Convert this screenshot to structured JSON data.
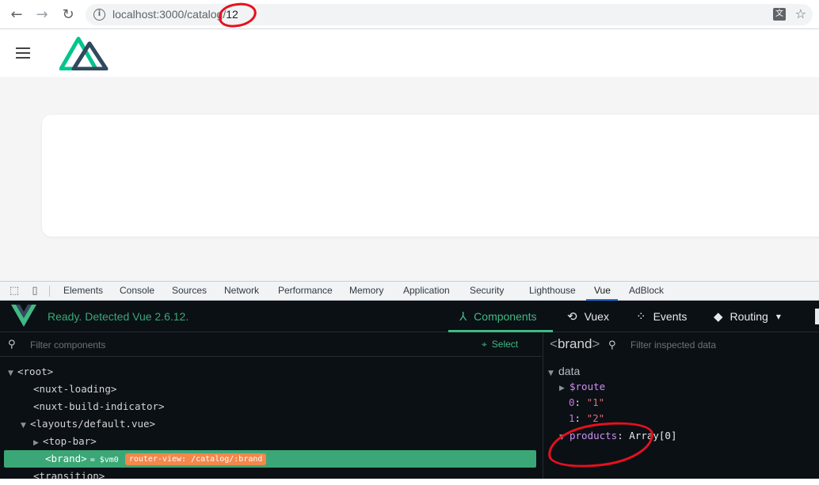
{
  "browser": {
    "url_host": "localhost:3000/catalog/",
    "url_path": "12",
    "back_icon": "arrow-left-icon",
    "forward_icon": "arrow-right-icon",
    "reload_icon": "reload-icon"
  },
  "devtools": {
    "tabs": [
      "Elements",
      "Console",
      "Sources",
      "Network",
      "Performance",
      "Memory",
      "Application",
      "Security",
      "Lighthouse",
      "Vue",
      "AdBlock"
    ],
    "active_tab": "Vue"
  },
  "vue": {
    "status": "Ready. Detected Vue 2.6.12.",
    "nav": {
      "components": "Components",
      "vuex": "Vuex",
      "events": "Events",
      "routing": "Routing"
    },
    "filter_placeholder": "Filter components",
    "select_label": "Select",
    "tree": [
      {
        "tag": "root"
      },
      {
        "tag": "nuxt-loading"
      },
      {
        "tag": "nuxt-build-indicator"
      },
      {
        "tag": "layouts/default.vue"
      },
      {
        "tag": "top-bar"
      },
      {
        "tag": "brand",
        "ref": "= $vm0",
        "badge": "router-view: /catalog/:brand"
      },
      {
        "tag": "transition"
      }
    ],
    "inspector": {
      "component": "brand",
      "filter_placeholder": "Filter inspected data",
      "section": "data",
      "route_key": "$route",
      "entries": [
        {
          "key": "0",
          "value": "\"1\""
        },
        {
          "key": "1",
          "value": "\"2\""
        }
      ],
      "products_key": "products",
      "products_value": "Array[0]"
    }
  },
  "colors": {
    "vue_green": "#42b983",
    "selected_row": "#3ba776",
    "badge_orange": "#f4874b",
    "annotation_red": "#e8101e"
  }
}
